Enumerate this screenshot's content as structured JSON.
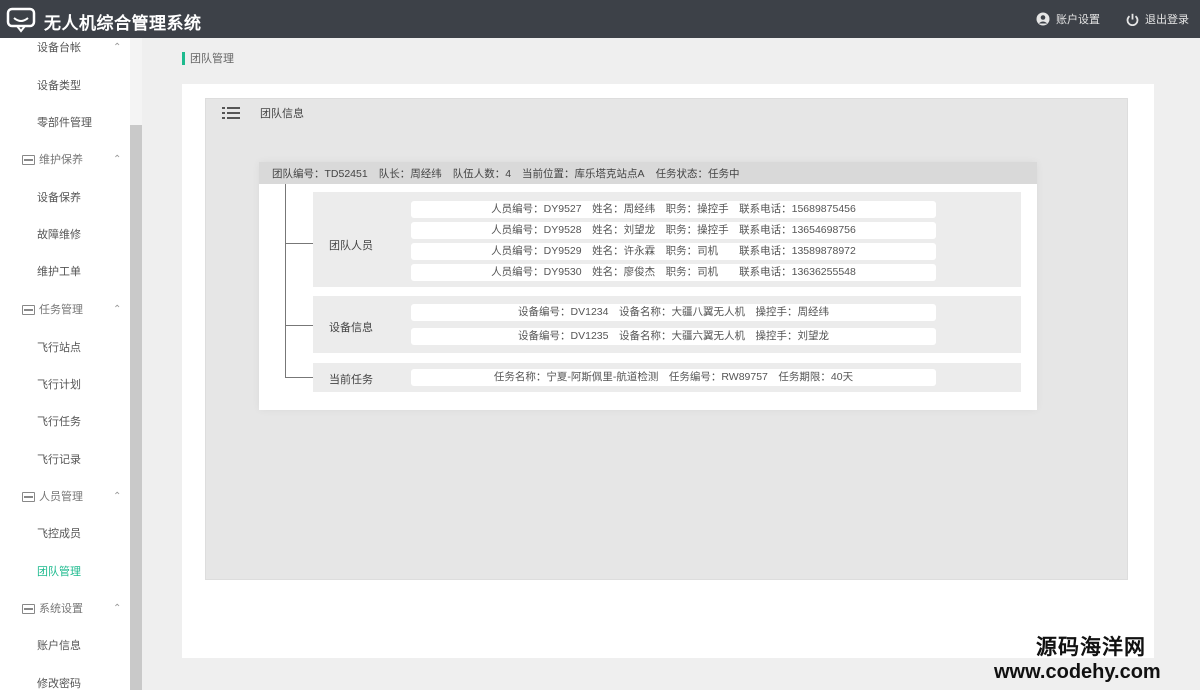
{
  "app": {
    "title": "无人机综合管理系统",
    "account_settings": "账户设置",
    "logout": "退出登录"
  },
  "sidebar": {
    "items": [
      {
        "label": "设备台帐",
        "type": "sub"
      },
      {
        "label": "设备类型",
        "type": "sub"
      },
      {
        "label": "零部件管理",
        "type": "sub"
      },
      {
        "label": "维护保养",
        "type": "group"
      },
      {
        "label": "设备保养",
        "type": "sub"
      },
      {
        "label": "故障维修",
        "type": "sub"
      },
      {
        "label": "维护工单",
        "type": "sub"
      },
      {
        "label": "任务管理",
        "type": "group"
      },
      {
        "label": "飞行站点",
        "type": "sub"
      },
      {
        "label": "飞行计划",
        "type": "sub"
      },
      {
        "label": "飞行任务",
        "type": "sub"
      },
      {
        "label": "飞行记录",
        "type": "sub"
      },
      {
        "label": "人员管理",
        "type": "group"
      },
      {
        "label": "飞控成员",
        "type": "sub"
      },
      {
        "label": "团队管理",
        "type": "sub",
        "active": true
      },
      {
        "label": "系统设置",
        "type": "group"
      },
      {
        "label": "账户信息",
        "type": "sub"
      },
      {
        "label": "修改密码",
        "type": "sub"
      }
    ]
  },
  "breadcrumb": "团队管理",
  "panel": {
    "title": "团队信息"
  },
  "team": {
    "summary": [
      "团队编号：TD52451",
      "队长：周经纬",
      "队伍人数：4",
      "当前位置：库乐塔克站点A",
      "任务状态：任务中"
    ],
    "members_label": "团队人员",
    "members": [
      "人员编号：DY9527　姓名：周经纬　职务：操控手　联系电话：15689875456",
      "人员编号：DY9528　姓名：刘望龙　职务：操控手　联系电话：13654698756",
      "人员编号：DY9529　姓名：许永霖　职务：司机　　联系电话：13589878972",
      "人员编号：DY9530　姓名：廖俊杰　职务：司机　　联系电话：13636255548"
    ],
    "devices_label": "设备信息",
    "devices": [
      "设备编号：DV1234　设备名称：大疆八翼无人机　操控手：周经纬",
      "设备编号：DV1235　设备名称：大疆六翼无人机　操控手：刘望龙"
    ],
    "task_label": "当前任务",
    "task": "任务名称：宁夏-阿斯佩里-航道检测　任务编号：RW89757　任务期限：40天"
  },
  "watermark": {
    "line1": "源码海洋网",
    "line2": "www.codehy.com"
  },
  "colors": {
    "topbar": "#3d4148",
    "accent": "#1dba8e"
  }
}
